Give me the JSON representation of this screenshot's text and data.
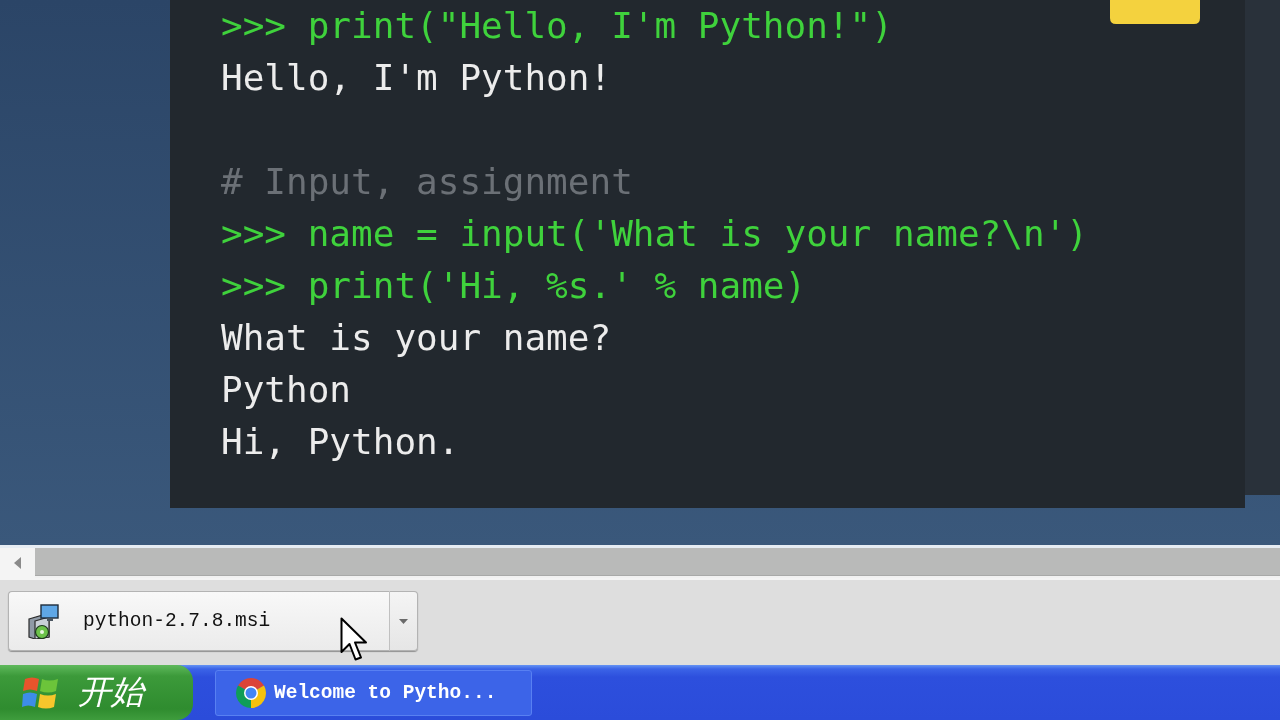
{
  "code_panel": {
    "lines": [
      {
        "kind": "input",
        "text": ">>> print(\"Hello, I'm Python!\")"
      },
      {
        "kind": "output",
        "text": "Hello, I'm Python!"
      },
      {
        "kind": "blank"
      },
      {
        "kind": "comment",
        "text": "# Input, assignment"
      },
      {
        "kind": "input",
        "text": ">>> name = input('What is your name?\\n')"
      },
      {
        "kind": "input",
        "text": ">>> print('Hi, %s.' % name)"
      },
      {
        "kind": "output",
        "text": "What is your name?"
      },
      {
        "kind": "output",
        "text": "Python"
      },
      {
        "kind": "output",
        "text": "Hi, Python."
      }
    ]
  },
  "download_bar": {
    "items": [
      {
        "filename": "python-2.7.8.msi"
      }
    ]
  },
  "taskbar": {
    "start_button": {
      "label": "开始"
    },
    "tasks": [
      {
        "label": "Welcome to Pytho...",
        "selected": false
      }
    ]
  }
}
